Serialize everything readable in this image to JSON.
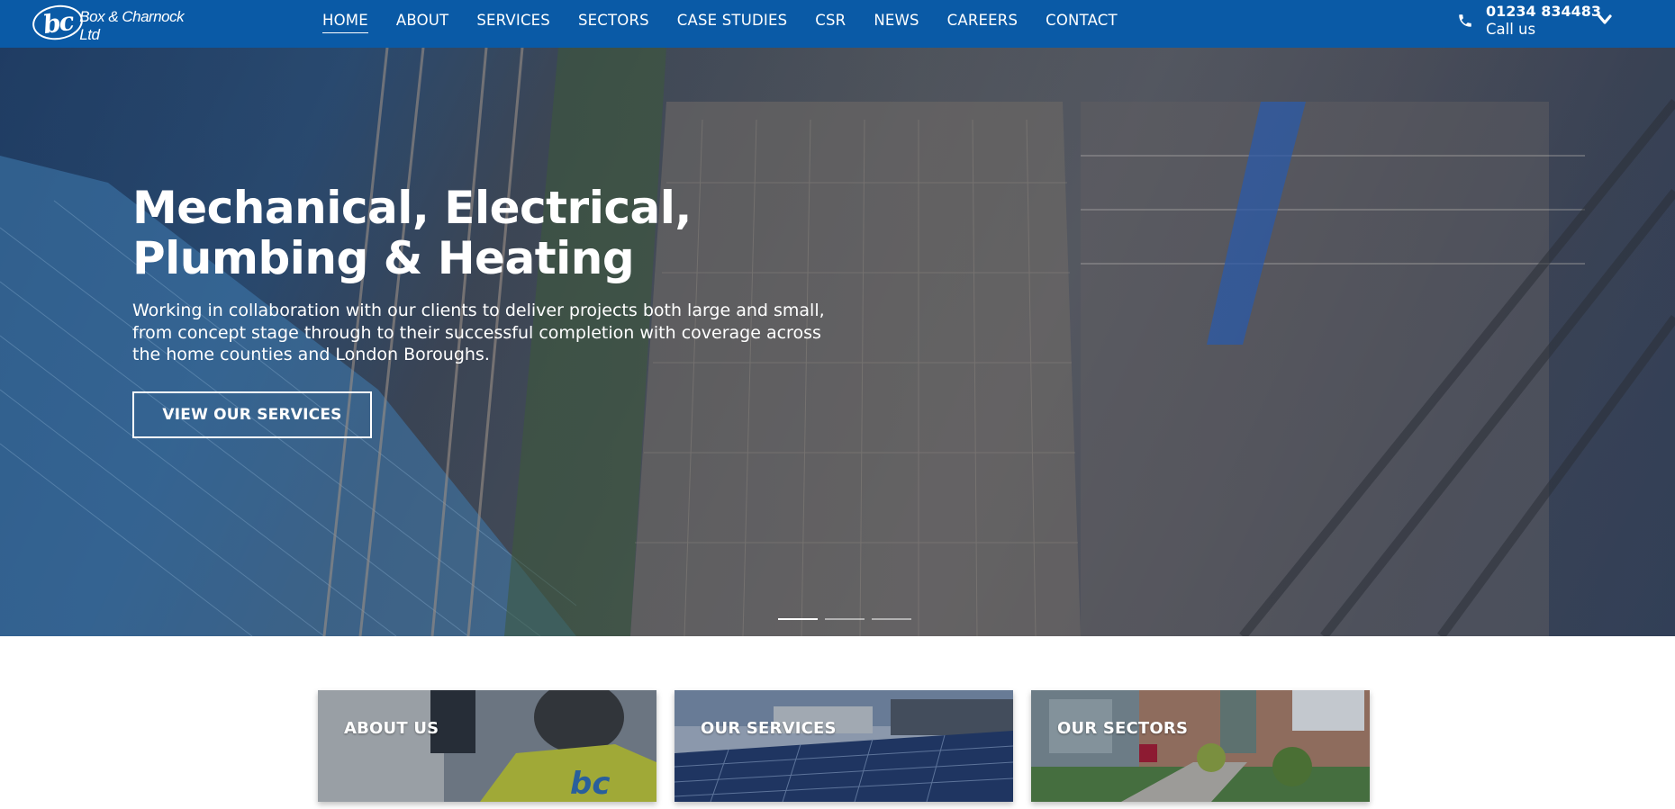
{
  "brand": {
    "logo_mark": "bc",
    "name": "Box & Charnock Ltd"
  },
  "nav": {
    "items": [
      {
        "label": "HOME",
        "active": true
      },
      {
        "label": "ABOUT"
      },
      {
        "label": "SERVICES"
      },
      {
        "label": "SECTORS"
      },
      {
        "label": "CASE STUDIES"
      },
      {
        "label": "CSR"
      },
      {
        "label": "NEWS"
      },
      {
        "label": "CAREERS"
      },
      {
        "label": "CONTACT"
      }
    ]
  },
  "contact": {
    "phone": "01234 834483",
    "label": "Call us",
    "icon": "phone-icon",
    "dropdown_icon": "chevron-down-icon"
  },
  "hero": {
    "title_line1": "Mechanical, Electrical,",
    "title_line2": "Plumbing & Heating",
    "subtitle_line1": "Working in collaboration with our clients to deliver projects both large and small,",
    "subtitle_line2": "from concept stage through to their successful completion with coverage across",
    "subtitle_line3": "the home counties and London Boroughs.",
    "button_label": "VIEW OUR SERVICES",
    "slides": 3,
    "active_slide": 1
  },
  "cards": [
    {
      "label": "ABOUT US"
    },
    {
      "label": "OUR SERVICES"
    },
    {
      "label": "OUR SECTORS"
    }
  ],
  "colors": {
    "header_bg": "#0a5aa6",
    "text": "#ffffff"
  }
}
